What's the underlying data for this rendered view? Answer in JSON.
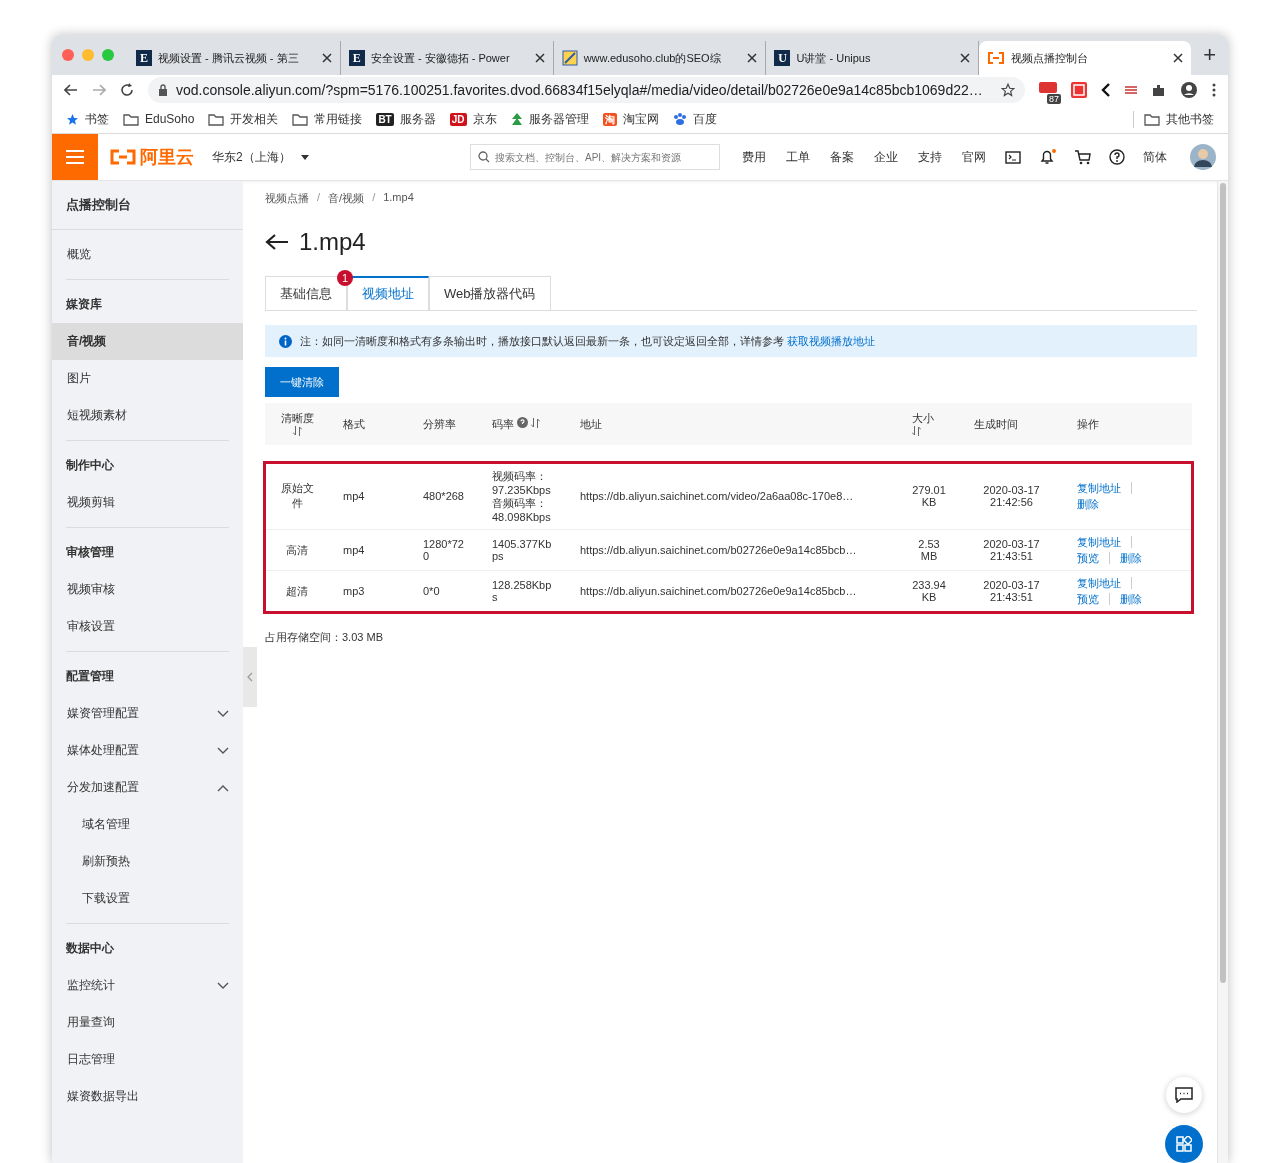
{
  "browser": {
    "tabs": [
      {
        "title": "视频设置 - 腾讯云视频 - 第三",
        "selected": false,
        "favicon": {
          "kind": "letter",
          "text": "E"
        }
      },
      {
        "title": "安全设置 - 安徽德拓 - Power",
        "selected": false,
        "favicon": {
          "kind": "letter",
          "text": "E"
        }
      },
      {
        "title": "www.edusoho.club的SEO综",
        "selected": false,
        "favicon": {
          "kind": "chart"
        }
      },
      {
        "title": "U讲堂 - Unipus",
        "selected": false,
        "favicon": {
          "kind": "letter",
          "text": "U"
        }
      },
      {
        "title": "视频点播控制台",
        "selected": true,
        "favicon": {
          "kind": "aliyun"
        }
      }
    ],
    "new_tab": "+",
    "url": "vod.console.aliyun.com/?spm=5176.100251.favorites.dvod.66834f15elyqla#/media/video/detail/b02726e0e9a14c85bcb1069d22…",
    "extension_badge": "87",
    "bookmarks": [
      {
        "label": "书签",
        "icon": {
          "kind": "star"
        }
      },
      {
        "label": "EduSoho",
        "icon": {
          "kind": "folder"
        }
      },
      {
        "label": "开发相关",
        "icon": {
          "kind": "folder"
        }
      },
      {
        "label": "常用链接",
        "icon": {
          "kind": "folder"
        }
      },
      {
        "label": "服务器",
        "icon": {
          "kind": "letter",
          "text": "BT",
          "color": "#222222"
        }
      },
      {
        "label": "京东",
        "icon": {
          "kind": "letter",
          "text": "JD",
          "color": "#d0121b"
        }
      },
      {
        "label": "服务器管理",
        "icon": {
          "kind": "leaf"
        }
      },
      {
        "label": "淘宝网",
        "icon": {
          "kind": "letter",
          "text": "淘",
          "color": "#f4511e"
        }
      },
      {
        "label": "百度",
        "icon": {
          "kind": "paw"
        }
      }
    ],
    "other_bookmarks": "其他书签"
  },
  "header": {
    "logo": "阿里云",
    "region": "华东2（上海）",
    "search": {
      "placeholder": "搜索文档、控制台、API、解决方案和资源"
    },
    "nav": [
      "费用",
      "工单",
      "备案",
      "企业",
      "支持",
      "官网"
    ],
    "bell_unread": true,
    "language": "简体"
  },
  "sidebar": {
    "title": "点播控制台",
    "sections": [
      {
        "items": [
          {
            "label": "概览",
            "selected": false
          }
        ]
      },
      {
        "title": "媒资库",
        "items": [
          {
            "label": "音/视频",
            "selected": true
          },
          {
            "label": "图片",
            "selected": false
          },
          {
            "label": "短视频素材",
            "selected": false
          }
        ]
      },
      {
        "title": "制作中心",
        "items": [
          {
            "label": "视频剪辑",
            "selected": false
          }
        ]
      },
      {
        "title": "审核管理",
        "items": [
          {
            "label": "视频审核",
            "selected": false
          },
          {
            "label": "审核设置",
            "selected": false
          }
        ]
      },
      {
        "title": "配置管理",
        "items": [
          {
            "label": "媒资管理配置",
            "selected": false,
            "expanded": false
          },
          {
            "label": "媒体处理配置",
            "selected": false,
            "expanded": false
          },
          {
            "label": "分发加速配置",
            "selected": false,
            "expanded": true,
            "children": [
              {
                "label": "域名管理",
                "selected": false
              },
              {
                "label": "刷新预热",
                "selected": false
              },
              {
                "label": "下载设置",
                "selected": false
              }
            ]
          }
        ]
      },
      {
        "title": "数据中心",
        "items": [
          {
            "label": "监控统计",
            "selected": false,
            "expanded": false
          },
          {
            "label": "用量查询",
            "selected": false
          },
          {
            "label": "日志管理",
            "selected": false
          },
          {
            "label": "媒资数据导出",
            "selected": false
          }
        ]
      }
    ]
  },
  "content": {
    "breadcrumb": [
      "视频点播",
      "音/视频",
      "1.mp4"
    ],
    "breadcrumb_separator": "/",
    "title": "1.mp4",
    "tabs": [
      {
        "label": "基础信息",
        "selected": false
      },
      {
        "label": "视频地址",
        "selected": true,
        "badge": "1"
      },
      {
        "label": "Web播放器代码",
        "selected": false
      }
    ],
    "notice": {
      "text": "注：如同一清晰度和格式有多条输出时，播放接口默认返回最新一条，也可设定返回全部，详情参考",
      "link": "获取视频播放地址"
    },
    "clear_button": "一键清除",
    "table": {
      "highlighted": true,
      "columns": [
        {
          "label": "清晰度",
          "kind": "sortable"
        },
        {
          "label": "格式",
          "kind": "plain"
        },
        {
          "label": "分辨率",
          "kind": "plain"
        },
        {
          "label": "码率",
          "kind": "help_sortable"
        },
        {
          "label": "地址",
          "kind": "plain"
        },
        {
          "label": "大小",
          "kind": "sortable"
        },
        {
          "label": "生成时间",
          "kind": "plain"
        },
        {
          "label": "操作",
          "kind": "plain"
        }
      ],
      "rows": [
        {
          "definition": "原始文件",
          "format": "mp4",
          "resolution": "480*268",
          "bitrate": "视频码率：97.235Kbps 音频码率：48.098Kbps",
          "address": "https://db.aliyun.saichinet.com/video/2a6aa08c-170e8…",
          "size": "279.01 KB",
          "created": "2020-03-17 21:42:56",
          "actions": [
            "复制地址",
            "删除"
          ]
        },
        {
          "definition": "高清",
          "format": "mp4",
          "resolution": "1280*720",
          "bitrate": "1405.377Kbps",
          "address": "https://db.aliyun.saichinet.com/b02726e0e9a14c85bcb…",
          "size": "2.53 MB",
          "created": "2020-03-17 21:43:51",
          "actions": [
            "复制地址",
            "预览",
            "删除"
          ]
        },
        {
          "definition": "超清",
          "format": "mp3",
          "resolution": "0*0",
          "bitrate": "128.258Kbps",
          "address": "https://db.aliyun.saichinet.com/b02726e0e9a14c85bcb…",
          "size": "233.94 KB",
          "created": "2020-03-17 21:43:51",
          "actions": [
            "复制地址",
            "预览",
            "删除"
          ]
        }
      ]
    },
    "storage": "占用存储空间：3.03 MB"
  }
}
